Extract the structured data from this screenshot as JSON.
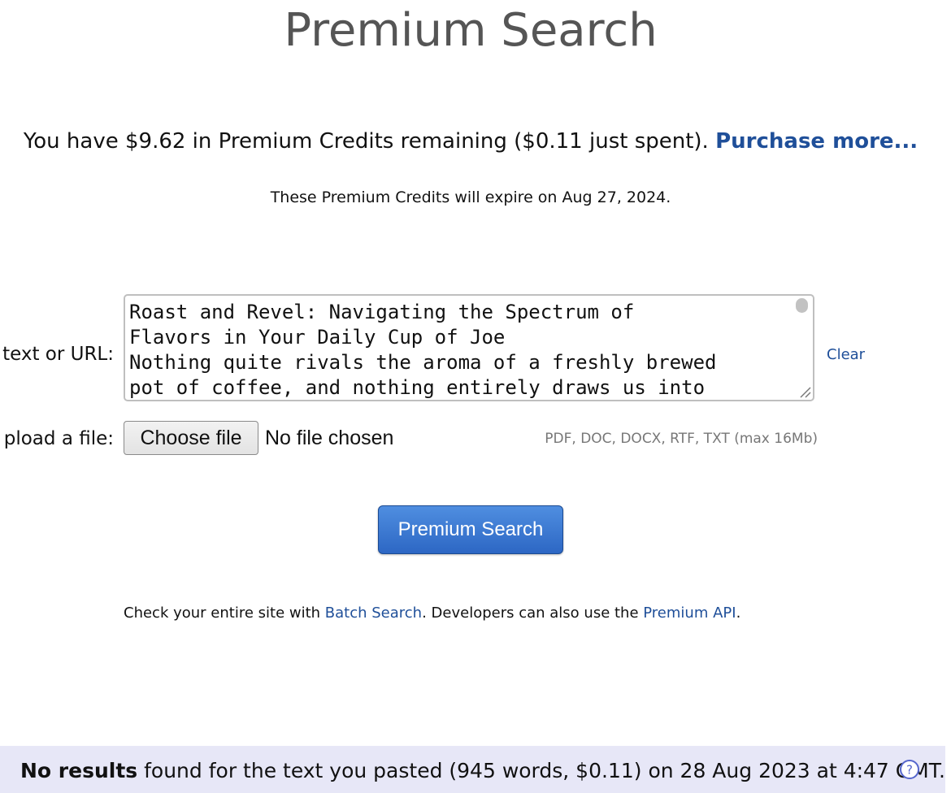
{
  "title": "Premium Search",
  "credits": {
    "text": "You have $9.62 in Premium Credits remaining ($0.11 just spent).",
    "purchase_link": "Purchase more..."
  },
  "expire_text": "These Premium Credits will expire on Aug 27, 2024.",
  "text_input": {
    "label": "text or URL:",
    "value": "Roast and Revel: Navigating the Spectrum of\nFlavors in Your Daily Cup of Joe\nNothing quite rivals the aroma of a freshly brewed\npot of coffee, and nothing entirely draws us into",
    "clear_label": "Clear"
  },
  "file_input": {
    "label": "pload a file:",
    "button_label": "Choose file",
    "status": "No file chosen",
    "hint": "PDF, DOC, DOCX, RTF, TXT (max 16Mb)"
  },
  "search_button": "Premium Search",
  "footer": {
    "prefix": "Check your entire site with ",
    "batch_link": "Batch Search",
    "middle": ". Developers can also use the ",
    "api_link": "Premium API",
    "suffix": "."
  },
  "result": {
    "bold": "No results",
    "text": " found for the text you pasted (945 words, $0.11) on 28 Aug 2023 at 4:47 GMT.",
    "icon": "help-icon"
  },
  "colors": {
    "link": "#1f4f99",
    "button": "#2d67c4",
    "result_bg": "#e7e7f7"
  }
}
